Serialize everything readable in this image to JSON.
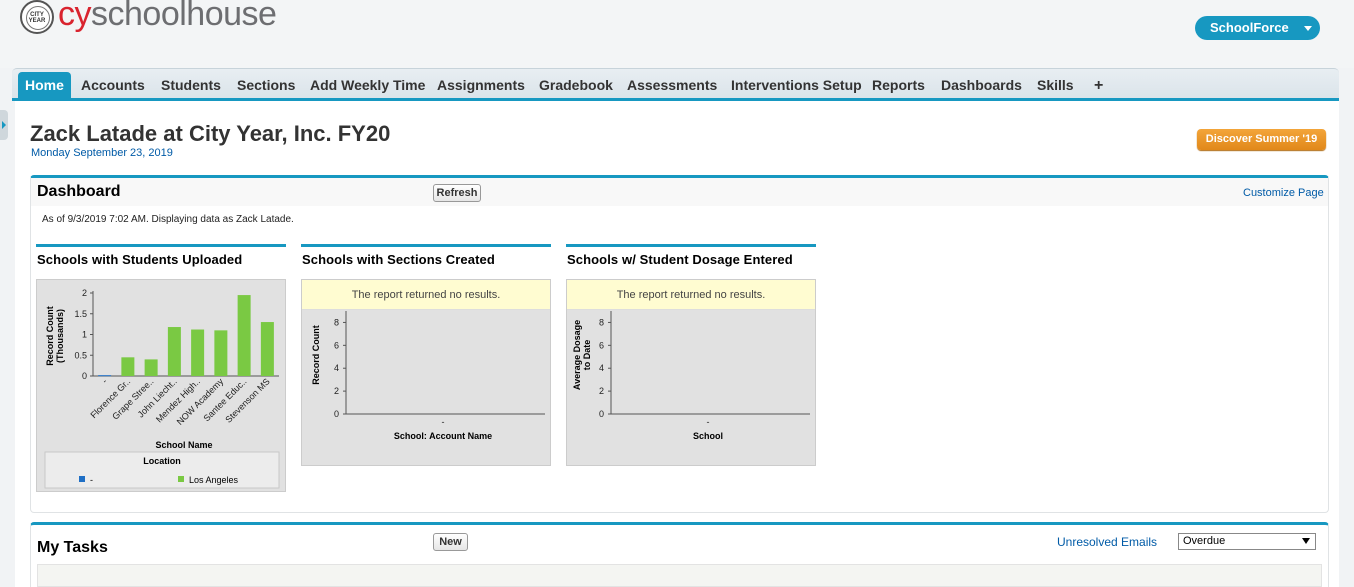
{
  "header": {
    "logo_seal": "CITY YEAR",
    "logo_cy": "cy",
    "logo_rest": "schoolhouse",
    "app_switcher": "SchoolForce"
  },
  "nav": {
    "tabs": [
      "Home",
      "Accounts",
      "Students",
      "Sections",
      "Add Weekly Time",
      "Assignments",
      "Gradebook",
      "Assessments",
      "Interventions Setup",
      "Reports",
      "Dashboards",
      "Skills",
      "+"
    ],
    "active": "Home"
  },
  "page": {
    "title": "Zack Latade at City Year, Inc. FY20",
    "date": "Monday September 23, 2019",
    "promo_button": "Discover Summer '19"
  },
  "dashboard": {
    "title": "Dashboard",
    "refresh_label": "Refresh",
    "customize_label": "Customize Page",
    "as_of": "As of 9/3/2019 7:02 AM. Displaying data as Zack Latade.",
    "components": [
      {
        "title": "Schools with Students Uploaded"
      },
      {
        "title": "Schools with Sections Created",
        "no_results": "The report returned no results."
      },
      {
        "title": "Schools w/ Student Dosage Entered",
        "no_results": "The report returned no results."
      }
    ]
  },
  "chart_data": [
    {
      "type": "bar",
      "title": "Schools with Students Uploaded",
      "ylabel": "Record Count (Thousands)",
      "xlabel": "School Name",
      "categories": [
        "-",
        "Florence Gr..",
        "Grape Stree..",
        "John Liecht..",
        "Mendez High..",
        "NOW Academy",
        "Santee Educ..",
        "Stevenson MS"
      ],
      "values": [
        0.02,
        0.45,
        0.4,
        1.18,
        1.12,
        1.1,
        1.95,
        1.3
      ],
      "bar_series": [
        "-",
        "Los Angeles",
        "Los Angeles",
        "Los Angeles",
        "Los Angeles",
        "Los Angeles",
        "Los Angeles",
        "Los Angeles"
      ],
      "yticks": [
        "0",
        "0.5",
        "1",
        "1.5",
        "2"
      ],
      "ylim": [
        0,
        2
      ],
      "legend_title": "Location",
      "series": [
        {
          "name": "-",
          "color": "#1f6fc5"
        },
        {
          "name": "Los Angeles",
          "color": "#7ac943"
        }
      ]
    },
    {
      "type": "bar",
      "title": "Schools with Sections Created",
      "ylabel": "Record Count",
      "xlabel": "School: Account Name",
      "categories": [
        "-"
      ],
      "values": [],
      "yticks": [
        "0",
        "2",
        "4",
        "6",
        "8"
      ],
      "ylim": [
        0,
        9
      ]
    },
    {
      "type": "bar",
      "title": "Schools w/ Student Dosage Entered",
      "ylabel": "Average Dosage to Date",
      "xlabel": "School",
      "categories": [
        "-"
      ],
      "values": [],
      "yticks": [
        "0",
        "2",
        "4",
        "6",
        "8"
      ],
      "ylim": [
        0,
        9
      ]
    }
  ],
  "tasks": {
    "title": "My Tasks",
    "new_label": "New",
    "unresolved_label": "Unresolved Emails",
    "filter_value": "Overdue"
  }
}
